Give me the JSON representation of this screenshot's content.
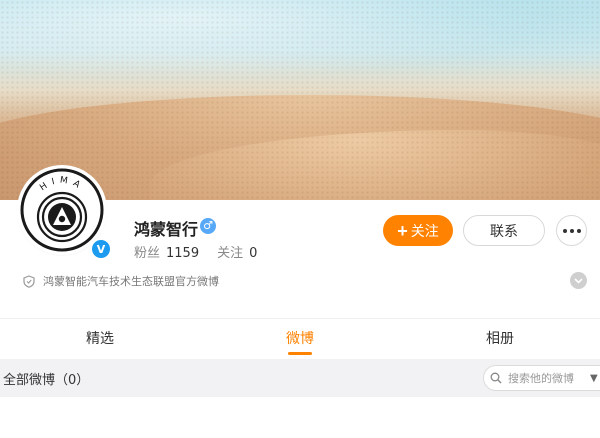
{
  "profile": {
    "avatar_logo_text": "HIMA",
    "verified_mark": "V",
    "name": "鸿蒙智行",
    "gender_symbol": "♂",
    "followers_label": "粉丝",
    "followers_count": "1159",
    "following_label": "关注",
    "following_count": "0",
    "bio": "鸿蒙智能汽车技术生态联盟官方微博"
  },
  "actions": {
    "follow_plus": "+",
    "follow_label": "关注",
    "contact_label": "联系"
  },
  "tabs": [
    {
      "label": "精选",
      "active": false
    },
    {
      "label": "微博",
      "active": true
    },
    {
      "label": "相册",
      "active": false
    }
  ],
  "feed": {
    "title": "全部微博（0）",
    "search_placeholder": "搜索他的微博"
  },
  "colors": {
    "accent": "#ff8200",
    "verified": "#1d9bf0",
    "gender": "#57a9f7"
  },
  "icons": {
    "bio": "shield-icon",
    "more": "more-dots-icon",
    "expand": "chevron-down-icon",
    "search": "search-icon"
  }
}
